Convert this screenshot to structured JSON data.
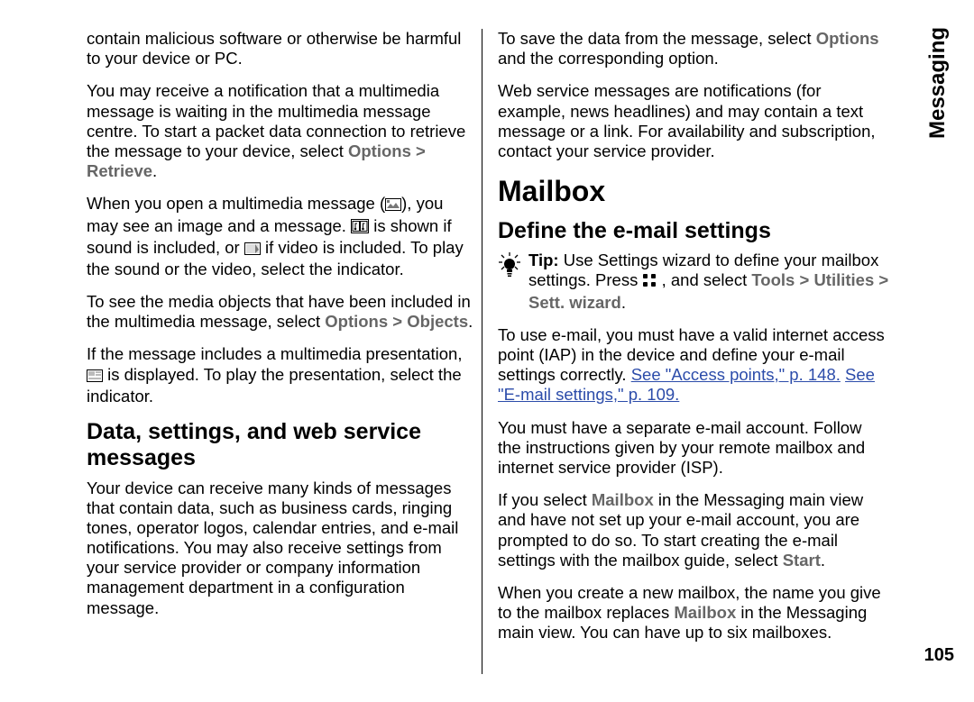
{
  "side_tab": "Messaging",
  "page_number": "105",
  "left": {
    "p1_a": "contain malicious software or otherwise be harmful to your device or PC.",
    "p2_a": "You may receive a notification that a multimedia message is waiting in the multimedia message centre. To start a packet data connection to retrieve the message to your device, select ",
    "p2_opt": "Options",
    "p2_gt": " > ",
    "p2_ret": "Retrieve",
    "p2_end": ".",
    "p3_a": "When you open a multimedia message (",
    "p3_b": "), you may see an image and a message. ",
    "p3_c": " is shown if sound is included, or ",
    "p3_d": " if video is included. To play the sound or the video, select the indicator.",
    "p4_a": "To see the media objects that have been included in the multimedia message, select ",
    "p4_opt": "Options",
    "p4_gt": " > ",
    "p4_obj": "Objects",
    "p4_end": ".",
    "p5_a": "If the message includes a multimedia presentation, ",
    "p5_b": " is displayed. To play the presentation, select the indicator.",
    "h2": "Data, settings, and web service messages",
    "p6": "Your device can receive many kinds of messages that contain data, such as business cards, ringing tones, operator logos, calendar entries, and e-mail notifications. You may also receive settings from your service provider or company information management department in a configuration message."
  },
  "right": {
    "p1_a": "To save the data from the message, select ",
    "p1_opt": "Options",
    "p1_b": " and the corresponding option.",
    "p2": "Web service messages are notifications (for example, news headlines) and may contain a text message or a link. For availability and subscription, contact your service provider.",
    "h1": "Mailbox",
    "h2": "Define the e-mail settings",
    "tip_label": "Tip:",
    "tip_a": " Use Settings wizard to define your mailbox settings. Press ",
    "tip_b": " , and select ",
    "tip_tools": "Tools",
    "tip_gt1": " > ",
    "tip_util": "Utilities",
    "tip_gt2": " > ",
    "tip_sett": "Sett. wizard",
    "tip_end": ".",
    "p3_a": "To use e-mail, you must have a valid internet access point (IAP) in the device and define your e-mail settings correctly. ",
    "p3_link1": "See \"Access points,\" p. 148.",
    "p3_sp": " ",
    "p3_link2": "See \"E-mail settings,\" p. 109.",
    "p4": "You must have a separate e-mail account. Follow the instructions given by your remote mailbox and internet service provider (ISP).",
    "p5_a": "If you select ",
    "p5_mb": "Mailbox",
    "p5_b": " in the Messaging main view and have not set up your e-mail account, you are prompted to do so. To start creating the e-mail settings with the mailbox guide, select ",
    "p5_start": "Start",
    "p5_end": ".",
    "p6_a": "When you create a new mailbox, the name you give to the mailbox replaces ",
    "p6_mb": "Mailbox",
    "p6_b": " in the Messaging main view. You can have up to six mailboxes."
  }
}
